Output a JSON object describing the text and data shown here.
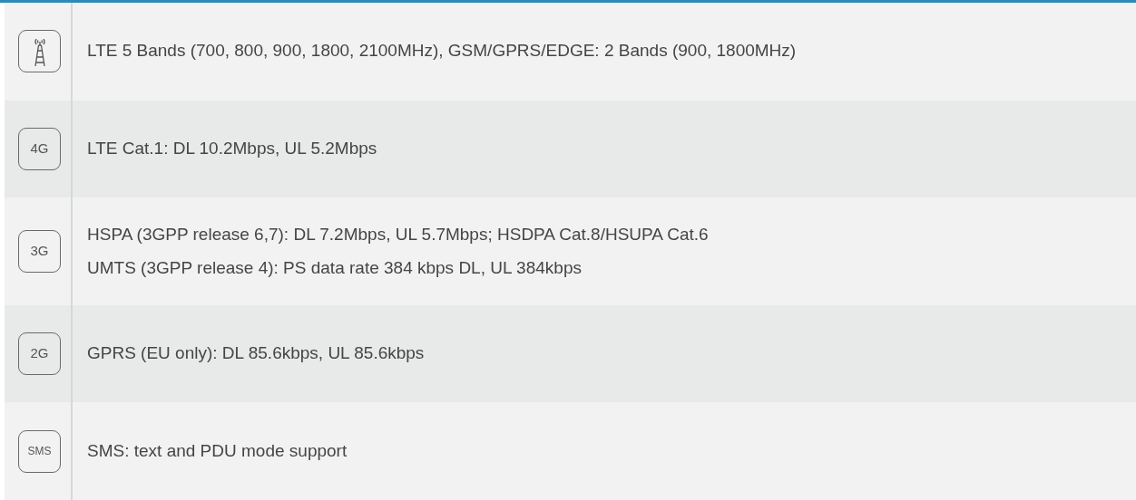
{
  "rows": [
    {
      "icon": {
        "kind": "tower"
      },
      "lines": [
        "LTE 5 Bands (700, 800, 900, 1800, 2100MHz), GSM/GPRS/EDGE: 2 Bands (900, 1800MHz)"
      ]
    },
    {
      "icon": {
        "kind": "label",
        "text": "4G"
      },
      "lines": [
        "LTE Cat.1: DL 10.2Mbps, UL 5.2Mbps"
      ]
    },
    {
      "icon": {
        "kind": "label",
        "text": "3G"
      },
      "lines": [
        "HSPA (3GPP release 6,7): DL 7.2Mbps, UL 5.7Mbps; HSDPA Cat.8/HSUPA Cat.6",
        "UMTS (3GPP release 4): PS data rate 384 kbps DL, UL 384kbps"
      ]
    },
    {
      "icon": {
        "kind": "label",
        "text": "2G"
      },
      "lines": [
        "GPRS (EU only): DL 85.6kbps, UL 85.6kbps"
      ]
    },
    {
      "icon": {
        "kind": "label",
        "text": "SMS"
      },
      "lines": [
        "SMS: text and PDU mode support"
      ]
    }
  ]
}
